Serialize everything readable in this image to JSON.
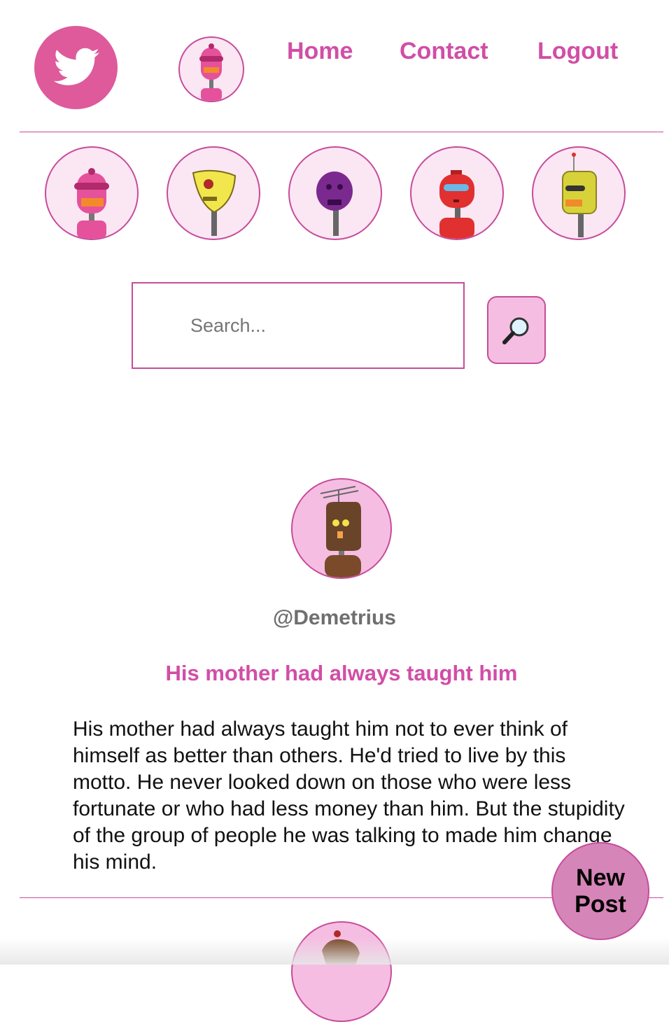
{
  "header": {
    "logo_icon": "bird-icon",
    "nav": [
      {
        "label": "Home"
      },
      {
        "label": "Contact"
      },
      {
        "label": "Logout"
      }
    ]
  },
  "robots": [
    {
      "name": "pink-robot",
      "color": "#e6519b"
    },
    {
      "name": "yellow-robot",
      "color": "#f1e64c"
    },
    {
      "name": "purple-robot",
      "color": "#7a2a8f"
    },
    {
      "name": "red-robot",
      "color": "#e0302f"
    },
    {
      "name": "yellow-antenna-robot",
      "color": "#d8d23a"
    }
  ],
  "search": {
    "placeholder": "Search...",
    "button_icon": "magnifier-icon"
  },
  "post": {
    "username": "@Demetrius",
    "title": "His mother had always taught him",
    "body": "His mother had always taught him not to ever think of himself as better than others. He'd tried to live by this motto. He never looked down on those who were less fortunate or who had less money than him. But the stupidity of the group of people he was talking to made him change his mind."
  },
  "new_post": {
    "label": "New Post"
  },
  "colors": {
    "accent": "#d14ea6",
    "border": "#c64c9b",
    "logo_bg": "#de5a9b",
    "avatar_bg": "#fbe6f3"
  }
}
